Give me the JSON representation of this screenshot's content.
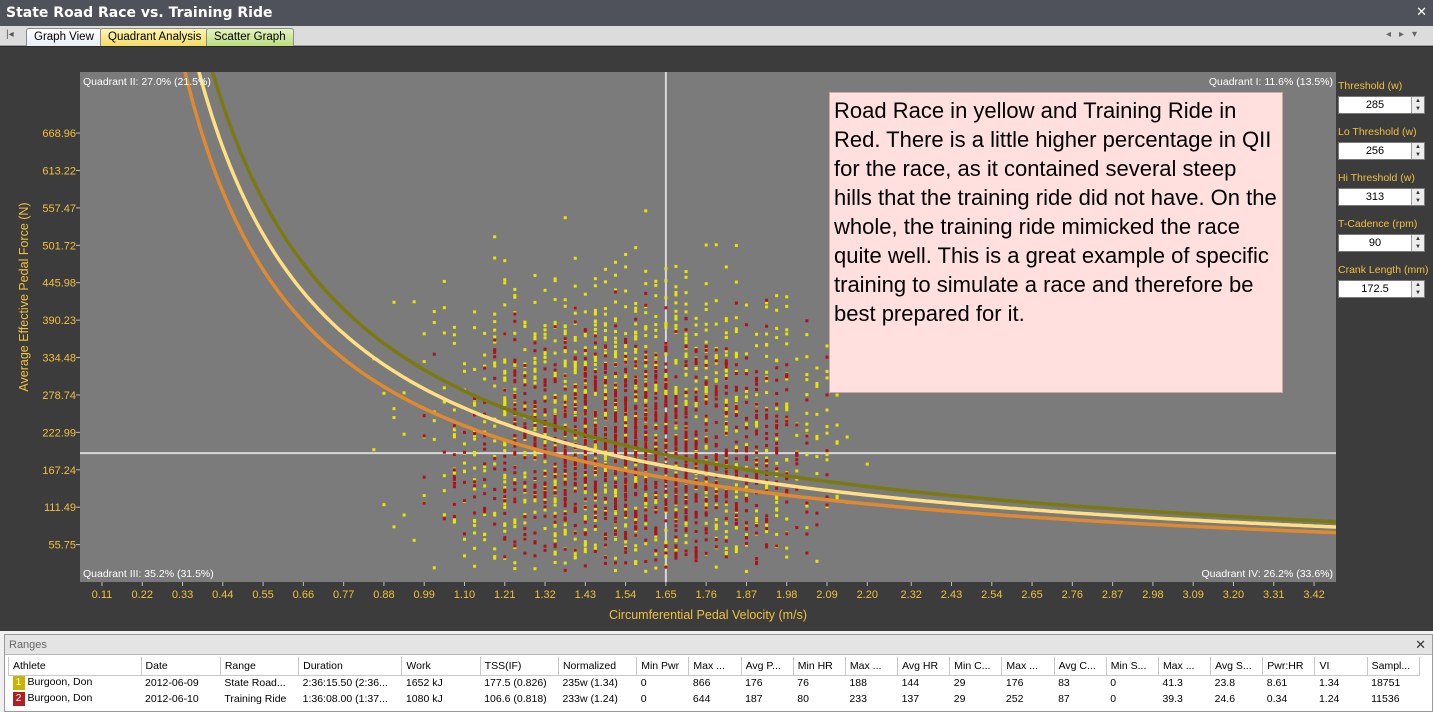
{
  "window": {
    "title": "State Road Race vs. Training Ride",
    "close_label": "✕"
  },
  "tabs": [
    {
      "label": "Graph View"
    },
    {
      "label": "Quadrant Analysis"
    },
    {
      "label": "Scatter Graph"
    }
  ],
  "chart_data": {
    "type": "scatter",
    "xlabel": "Circumferential Pedal Velocity (m/s)",
    "ylabel": "Average Effective Pedal Force (N)",
    "xlim": [
      0.05,
      3.48
    ],
    "ylim": [
      0,
      760
    ],
    "x_ticks": [
      "0.11",
      "0.22",
      "0.33",
      "0.44",
      "0.55",
      "0.66",
      "0.77",
      "0.88",
      "0.99",
      "1.10",
      "1.21",
      "1.32",
      "1.43",
      "1.54",
      "1.65",
      "1.76",
      "1.87",
      "1.98",
      "2.09",
      "2.20",
      "2.32",
      "2.43",
      "2.54",
      "2.65",
      "2.76",
      "2.87",
      "2.98",
      "3.09",
      "3.20",
      "3.31",
      "3.42"
    ],
    "y_ticks": [
      "55.75",
      "111.49",
      "167.24",
      "222.99",
      "278.74",
      "334.48",
      "390.23",
      "445.98",
      "501.72",
      "557.47",
      "613.22",
      "668.96"
    ],
    "quadrant_lines": {
      "x": 1.65,
      "y": 192
    },
    "quadrant_labels": {
      "q1": "Quadrant I: 11.6% (13.5%)",
      "q2": "Quadrant II: 27.0% (21.5%)",
      "q3": "Quadrant III: 35.2% (31.5%)",
      "q4": "Quadrant IV: 26.2% (33.6%)"
    },
    "threshold_curves": [
      {
        "power_w": 313,
        "color": "#7a7a10"
      },
      {
        "power_w": 285,
        "color": "#ffe080"
      },
      {
        "power_w": 256,
        "color": "#e08a30"
      }
    ],
    "series": [
      {
        "color": "#e6e600",
        "x_center": 1.55,
        "x_spread": 0.26,
        "y_center": 230,
        "y_spread": 110,
        "x_range": [
          0.5,
          2.2
        ],
        "y_range": [
          15,
          600
        ]
      },
      {
        "color": "#b0101a",
        "x_center": 1.58,
        "x_spread": 0.22,
        "y_center": 200,
        "y_spread": 85,
        "x_range": [
          0.5,
          2.1
        ],
        "y_range": [
          15,
          470
        ]
      }
    ]
  },
  "annotation": "Road Race in yellow and Training Ride in Red.  There is a little higher percentage in QII for the race, as it contained several steep hills that the training ride did not have.  On the whole, the training ride mimicked the race quite well.  This is a great example of specific training to simulate a race and therefore be best prepared for it.",
  "settings": {
    "threshold": {
      "label": "Threshold (w)",
      "value": "285"
    },
    "lo_threshold": {
      "label": "Lo Threshold (w)",
      "value": "256"
    },
    "hi_threshold": {
      "label": "Hi Threshold (w)",
      "value": "313"
    },
    "t_cadence": {
      "label": "T-Cadence (rpm)",
      "value": "90"
    },
    "crank_length": {
      "label": "Crank Length (mm)",
      "value": "172.5"
    }
  },
  "ranges": {
    "title": "Ranges",
    "close_label": "✕",
    "columns": [
      "Athlete",
      "Date",
      "Range",
      "Duration",
      "Work",
      "TSS(IF)",
      "Normalized",
      "Min Pwr",
      "Max ...",
      "Avg P...",
      "Min HR",
      "Max ...",
      "Avg HR",
      "Min C...",
      "Max ...",
      "Avg C...",
      "Min S...",
      "Max ...",
      "Avg S...",
      "Pwr:HR",
      "VI",
      "Sampl..."
    ],
    "rows": [
      {
        "num": "1",
        "cells": [
          "Burgoon, Don",
          "2012-06-09",
          "State Road...",
          "2:36:15.50 (2:36...",
          "1652 kJ",
          "177.5 (0.826)",
          "235w (1.34)",
          "0",
          "866",
          "176",
          "76",
          "188",
          "144",
          "29",
          "176",
          "83",
          "0",
          "41.3",
          "23.8",
          "8.61",
          "1.34",
          "18751"
        ]
      },
      {
        "num": "2",
        "cells": [
          "Burgoon, Don",
          "2012-06-10",
          "Training Ride",
          "1:36:08.00 (1:37...",
          "1080 kJ",
          "106.6 (0.818)",
          "233w (1.24)",
          "0",
          "644",
          "187",
          "80",
          "233",
          "137",
          "29",
          "252",
          "87",
          "0",
          "39.3",
          "24.6",
          "0.34",
          "1.24",
          "11536"
        ]
      }
    ]
  }
}
